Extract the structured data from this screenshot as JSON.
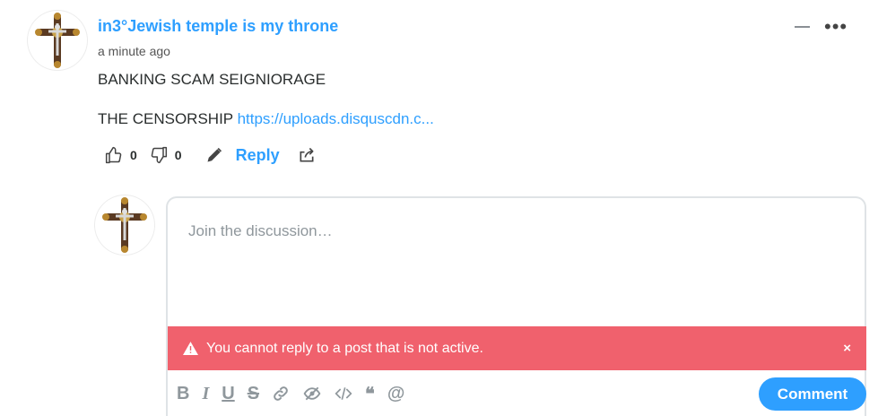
{
  "post": {
    "author": "in3°Jewish temple is my throne",
    "time": "a minute ago",
    "body_line1": "BANKING SCAM SEIGNIORAGE",
    "body_line2_prefix": "THE CENSORSHIP ",
    "body_line2_link": "https://uploads.disquscdn.c...",
    "upvotes": "0",
    "downvotes": "0",
    "reply_label": "Reply"
  },
  "composer": {
    "placeholder": "Join the discussion…",
    "alert_text": "You cannot reply to a post that is not active.",
    "alert_close": "×",
    "comment_label": "Comment",
    "toolbar": [
      "bold-icon",
      "italic-icon",
      "underline-icon",
      "strikethrough-icon",
      "link-icon",
      "spoiler-icon",
      "code-icon",
      "quote-icon",
      "mention-icon"
    ]
  },
  "colors": {
    "accent": "#2e9fff",
    "alert": "#f0616d"
  }
}
